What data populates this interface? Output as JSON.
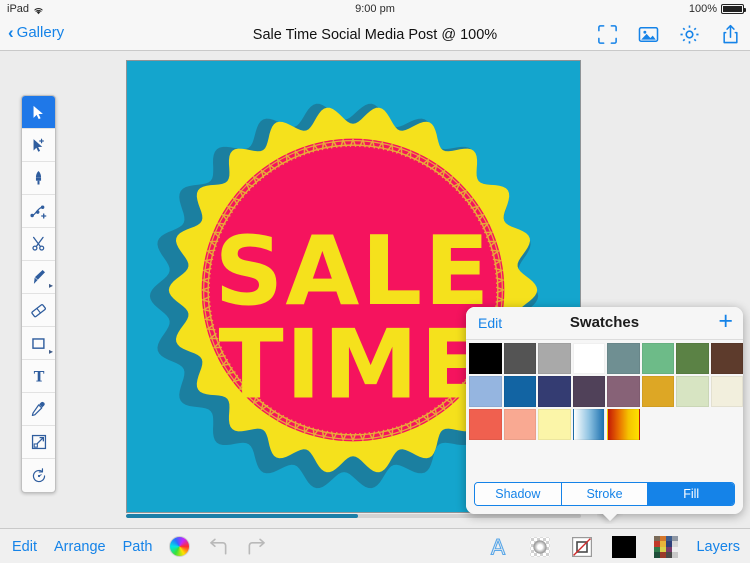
{
  "status_bar": {
    "device": "iPad",
    "wifi_icon": "wifi-icon",
    "time": "9:00 pm",
    "battery_percent": "100%",
    "battery_icon": "battery-full-icon"
  },
  "nav_bar": {
    "back_label": "Gallery",
    "back_chevron": "chevron-left-icon",
    "title": "Sale Time Social Media Post @ 100%",
    "actions": [
      {
        "name": "fit-to-screen-icon",
        "label": "Fit to Screen"
      },
      {
        "name": "image-icon",
        "label": "Insert Image"
      },
      {
        "name": "gear-icon",
        "label": "Settings"
      },
      {
        "name": "share-icon",
        "label": "Share"
      }
    ]
  },
  "tool_palette": {
    "tools": [
      {
        "name": "select-tool",
        "label": "Select",
        "icon": "cursor-arrow-icon",
        "selected": true,
        "has_submenu": false
      },
      {
        "name": "direct-select-tool",
        "label": "Direct Select",
        "icon": "cursor-plus-icon",
        "selected": false,
        "has_submenu": false
      },
      {
        "name": "pen-tool",
        "label": "Pen",
        "icon": "pen-nib-icon",
        "selected": false,
        "has_submenu": false
      },
      {
        "name": "add-point-tool",
        "label": "Add Point",
        "icon": "node-plus-icon",
        "selected": false,
        "has_submenu": false
      },
      {
        "name": "scissors-tool",
        "label": "Scissors",
        "icon": "scissors-icon",
        "selected": false,
        "has_submenu": false
      },
      {
        "name": "brush-tool",
        "label": "Brush",
        "icon": "paintbrush-icon",
        "selected": false,
        "has_submenu": true
      },
      {
        "name": "eraser-tool",
        "label": "Eraser",
        "icon": "eraser-icon",
        "selected": false,
        "has_submenu": false
      },
      {
        "name": "shape-tool",
        "label": "Shape",
        "icon": "rectangle-icon",
        "selected": false,
        "has_submenu": true
      },
      {
        "name": "text-tool",
        "label": "Text",
        "icon": "text-t-icon",
        "selected": false,
        "has_submenu": false
      },
      {
        "name": "eyedropper-tool",
        "label": "Eyedropper",
        "icon": "eyedropper-icon",
        "selected": false,
        "has_submenu": false
      },
      {
        "name": "transform-tool",
        "label": "Transform",
        "icon": "scale-arrow-icon",
        "selected": false,
        "has_submenu": false
      },
      {
        "name": "rotate-tool",
        "label": "Rotate",
        "icon": "rotate-icon",
        "selected": false,
        "has_submenu": false
      }
    ]
  },
  "canvas": {
    "name": "artboard",
    "zoom": "100%",
    "background_color": "#14a5cd",
    "artwork": {
      "title_line_1": "SALE",
      "title_line_2": "TIME",
      "shadow_ring_color": "#1b7fa0",
      "outer_scallop_color": "#f5e11c",
      "disc_color": "#f5135e",
      "laurel_color": "#e8a93a",
      "text_color": "#f5e11c"
    }
  },
  "swatches_popover": {
    "edit_label": "Edit",
    "title": "Swatches",
    "add_icon": "plus-icon",
    "rows": [
      [
        "#000000",
        "#545454",
        "#a9a9a9",
        "#ffffff",
        "#6f8f92",
        "#6dbb88",
        "#5b8245",
        "#5d3b2c"
      ],
      [
        "#95b5e0",
        "#1264a3",
        "#343c72",
        "#504159",
        "#876277",
        "#dda725",
        "#d7e4c2",
        "#f2efdd"
      ],
      [
        "#f0604f",
        "#f9a992",
        "#fbf5a8",
        "gradient-blue",
        "gradient-orange",
        "",
        "",
        ""
      ]
    ],
    "gradients": {
      "gradient-blue": [
        "#ffffff",
        "#8fc3e2",
        "#1b6fae"
      ],
      "gradient-orange": [
        "#c41a06",
        "#e86a00",
        "#f5c400",
        "#ffe000"
      ]
    },
    "segments": [
      {
        "label": "Shadow",
        "active": false
      },
      {
        "label": "Stroke",
        "active": false
      },
      {
        "label": "Fill",
        "active": true
      }
    ]
  },
  "bottom_bar": {
    "left_items": [
      {
        "name": "edit-menu",
        "label": "Edit"
      },
      {
        "name": "arrange-menu",
        "label": "Arrange"
      },
      {
        "name": "path-menu",
        "label": "Path"
      }
    ],
    "color_wheel_icon": "color-wheel-icon",
    "undo_icon": "undo-arrow-icon",
    "redo_icon": "redo-arrow-icon",
    "right_items": [
      {
        "name": "font-a-icon",
        "label": "Text Style"
      },
      {
        "name": "shadow-icon",
        "label": "Shadow"
      },
      {
        "name": "stroke-none-icon",
        "label": "Stroke"
      },
      {
        "name": "fill-color-swatch",
        "label": "Fill",
        "color": "#000000"
      },
      {
        "name": "palette-grid-icon",
        "label": "Palette"
      }
    ],
    "layers_label": "Layers"
  }
}
